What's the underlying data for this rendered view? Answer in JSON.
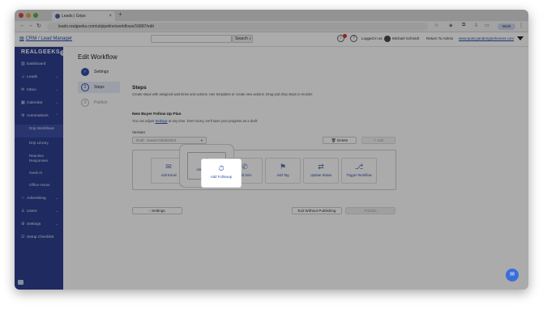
{
  "browser": {
    "tab_title": "Leads | Grips",
    "tab_close": "×",
    "new_tab": "+",
    "url": "leads.realgeeks.com/ui/pipeline/workflows/16887/edit",
    "profile_label": "Work"
  },
  "header": {
    "breadcrumb": "CRM / Lead Manager",
    "search_button": "Search",
    "logged_in_as": "Logged in as",
    "user_name": "Michael Schmidt",
    "return_admin": "Return To Admin",
    "site_link": "www.quincyandenginehomes.com"
  },
  "sidebar": {
    "logo": "REALGEEKS",
    "items": [
      {
        "label": "Dashboard",
        "icon": "dashboard-icon"
      },
      {
        "label": "Leads",
        "icon": "people-icon"
      },
      {
        "label": "Inbox",
        "icon": "mail-icon"
      },
      {
        "label": "Calendar",
        "icon": "calendar-icon"
      },
      {
        "label": "Automations",
        "icon": "automation-icon"
      },
      {
        "label": "Advertising",
        "icon": "star-icon"
      },
      {
        "label": "Users",
        "icon": "user-icon"
      },
      {
        "label": "Settings",
        "icon": "gear-icon"
      },
      {
        "label": "Setup Checklist",
        "icon": "checklist-icon"
      }
    ],
    "sub_items": [
      "Drip Workflows",
      "Drip Library",
      "Reactive Responses",
      "Geek AI",
      "Office Hours"
    ]
  },
  "main": {
    "page_title": "Edit Workflow",
    "steps": [
      {
        "num": "✓",
        "label": "Settings"
      },
      {
        "num": "2",
        "label": "Steps"
      },
      {
        "num": "3",
        "label": "Publish"
      }
    ],
    "section_title": "Steps",
    "section_desc": "Create steps with assigned wait times and actions. Use templates or create new actions. Drag and drop steps to reorder.",
    "plan_name": "New Buyer Follow Up Plan",
    "plan_note_pre": "You can adjust",
    "plan_note_link": "Settings",
    "plan_note_post": "at any time. Don't worry, we'll save your progress as a draft.",
    "version_label": "Version",
    "version_value": "Draft - Saved 03/26/2024",
    "delete_label": "Delete",
    "edit_label": "Edit",
    "tools": [
      {
        "label": "Add Email",
        "icon": "email-icon"
      },
      {
        "label": "Add Followup",
        "icon": "timer-icon"
      },
      {
        "label": "Add Sms",
        "icon": "sms-icon"
      },
      {
        "label": "Add Tag",
        "icon": "tag-icon"
      },
      {
        "label": "Update Status",
        "icon": "status-icon"
      },
      {
        "label": "Trigger Workflow",
        "icon": "workflow-icon"
      }
    ],
    "back_label": "Settings",
    "exit_label": "Exit Without Publishing",
    "publish_label": "Publish"
  }
}
